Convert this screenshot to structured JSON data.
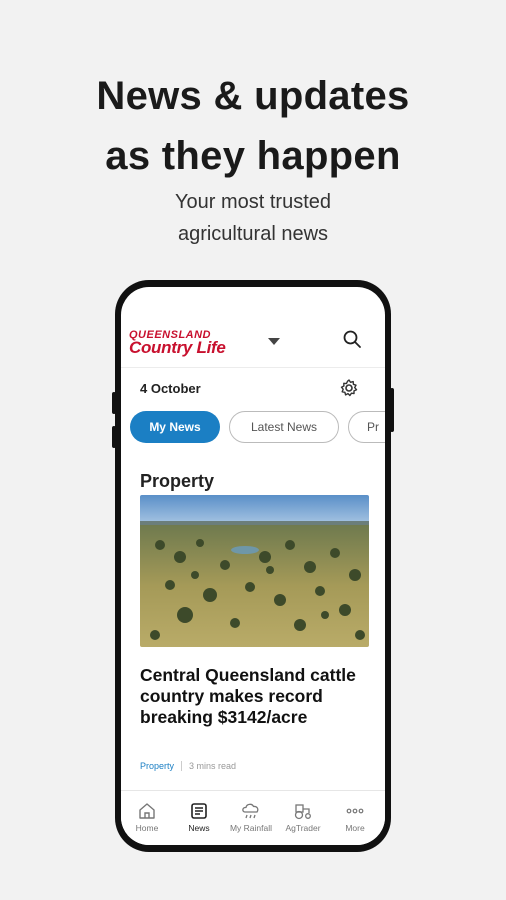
{
  "promo": {
    "headline_line1": "News & updates",
    "headline_line2": "as they happen",
    "subtitle_line1": "Your most trusted",
    "subtitle_line2": "agricultural news"
  },
  "app": {
    "logo_line1": "QUEENSLAND",
    "logo_line2": "Country Life",
    "brand_color": "#c8102e",
    "accent_color": "#1b7fc4",
    "date": "4 October",
    "tabs": [
      {
        "label": "My News",
        "active": true
      },
      {
        "label": "Latest News",
        "active": false
      },
      {
        "label": "Pr",
        "active": false
      }
    ],
    "section_title": "Property",
    "article": {
      "title": "Central Queensland cattle country makes record breaking $3142/acre",
      "tag": "Property",
      "read_time": "3 mins read"
    },
    "nav": [
      {
        "label": "Home",
        "icon": "home-icon"
      },
      {
        "label": "News",
        "icon": "newspaper-icon"
      },
      {
        "label": "My Rainfall",
        "icon": "rain-cloud-icon"
      },
      {
        "label": "AgTrader",
        "icon": "tractor-icon"
      },
      {
        "label": "More",
        "icon": "more-dots-icon"
      }
    ]
  }
}
